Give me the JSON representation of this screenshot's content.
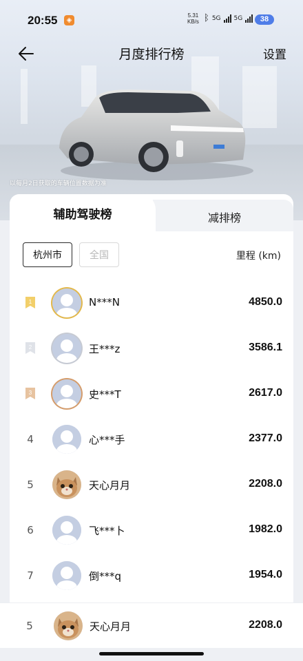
{
  "status": {
    "time": "20:55",
    "net_speed_value": "5.31",
    "net_speed_unit": "KB/s",
    "signal_1": "5G",
    "signal_2": "5G",
    "battery": "38"
  },
  "nav": {
    "title": "月度排行榜",
    "settings": "设置"
  },
  "hero": {
    "note": "以每月2日获取的车辆位置数据为准"
  },
  "tabs": {
    "active": "辅助驾驶榜",
    "inactive": "减排榜"
  },
  "filters": {
    "city": "杭州市",
    "all": "全国"
  },
  "column_header": "里程 (km)",
  "rows": [
    {
      "rank": "1",
      "name": "N***N",
      "km": "4850.0"
    },
    {
      "rank": "2",
      "name": "王***z",
      "km": "3586.1"
    },
    {
      "rank": "3",
      "name": "史***T",
      "km": "2617.0"
    },
    {
      "rank": "4",
      "name": "心***手",
      "km": "2377.0"
    },
    {
      "rank": "5",
      "name": "天心月月",
      "km": "2208.0"
    },
    {
      "rank": "6",
      "name": "飞***卜",
      "km": "1982.0"
    },
    {
      "rank": "7",
      "name": "倒***q",
      "km": "1954.0"
    }
  ],
  "mine": {
    "rank": "5",
    "name": "天心月月",
    "km": "2208.0"
  },
  "colors": {
    "gold": "#e3b84a",
    "silver": "#c6cad3",
    "bronze": "#d59c6a",
    "battery": "#4f7de8"
  }
}
